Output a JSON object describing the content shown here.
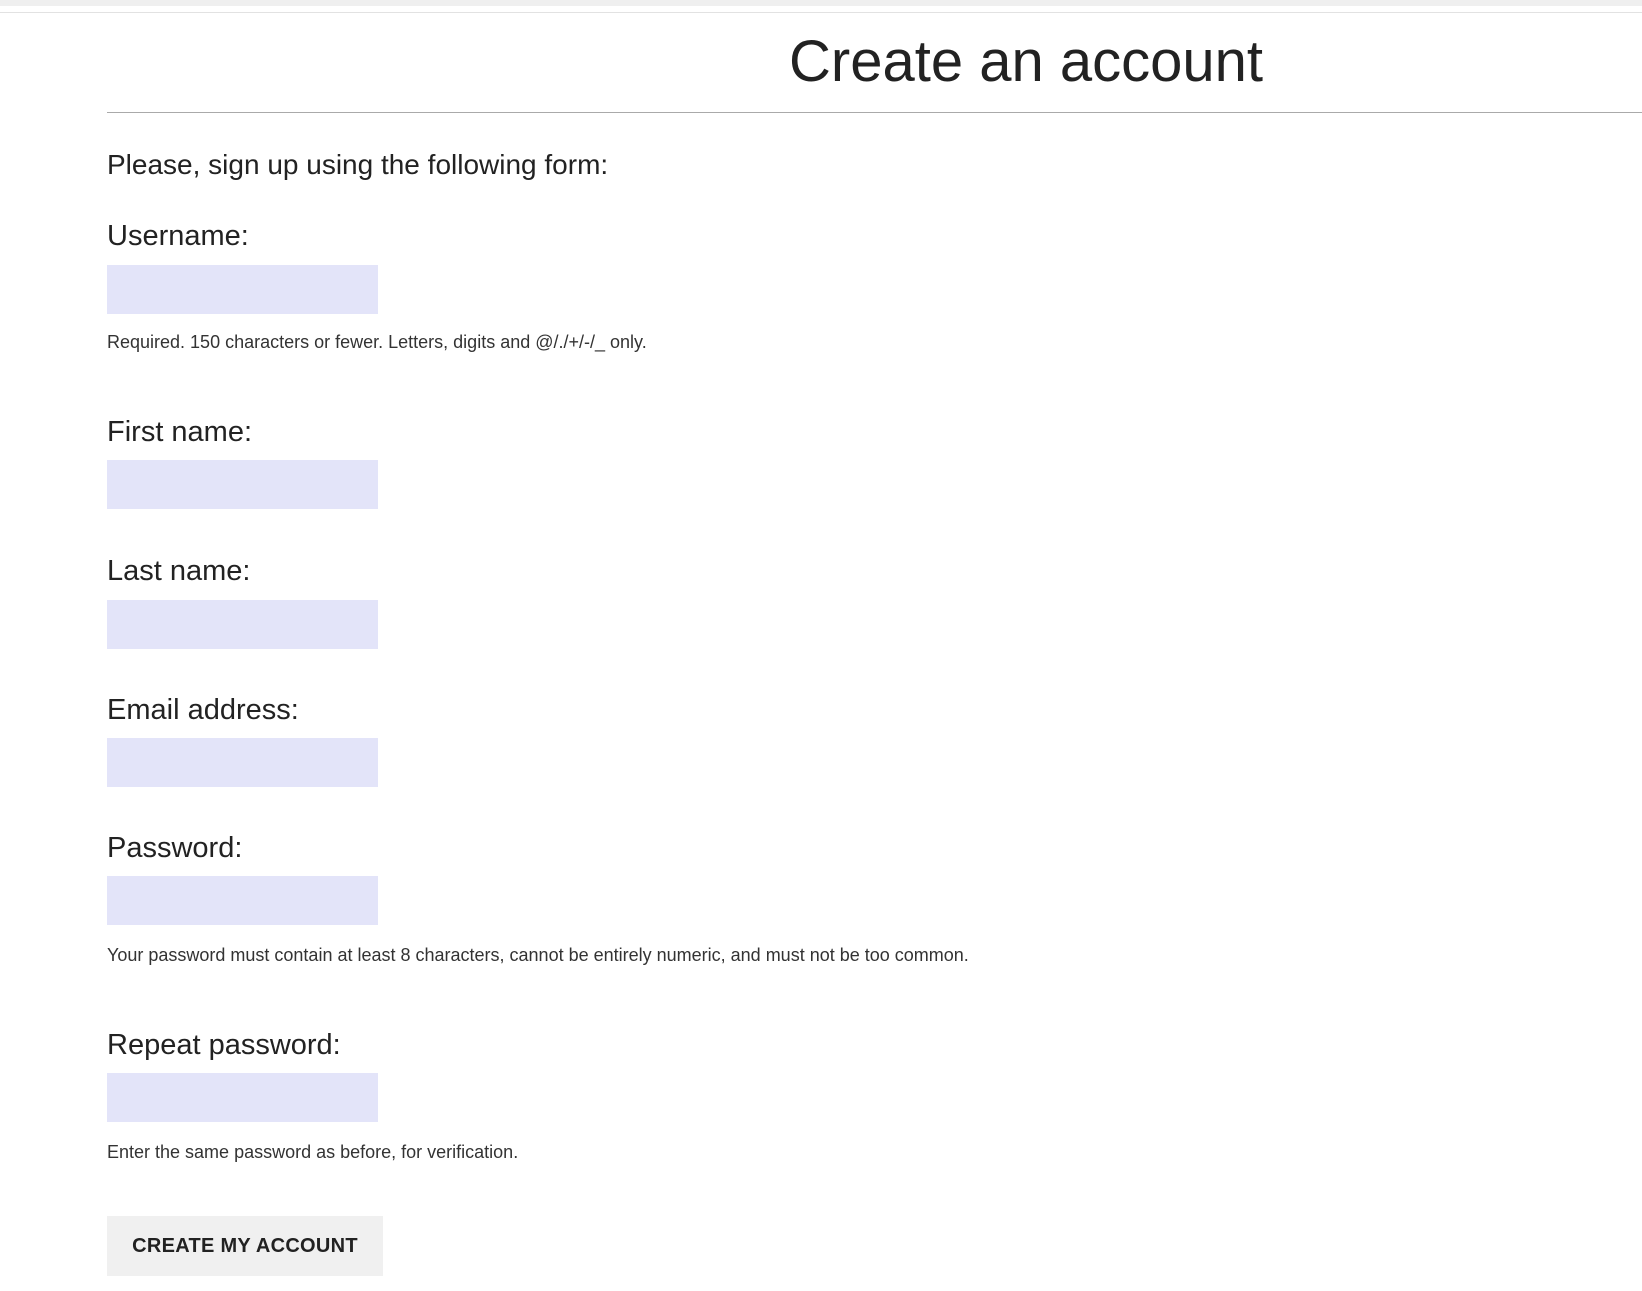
{
  "page": {
    "title": "Create an account",
    "intro": "Please, sign up using the following form:"
  },
  "form": {
    "username": {
      "label": "Username:",
      "value": "",
      "help": "Required. 150 characters or fewer. Letters, digits and @/./+/-/_ only."
    },
    "first_name": {
      "label": "First name:",
      "value": ""
    },
    "last_name": {
      "label": "Last name:",
      "value": ""
    },
    "email": {
      "label": "Email address:",
      "value": ""
    },
    "password": {
      "label": "Password:",
      "value": "",
      "help": "Your password must contain at least 8 characters, cannot be entirely numeric, and must not be too common."
    },
    "repeat_password": {
      "label": "Repeat password:",
      "value": "",
      "help": "Enter the same password as before, for verification."
    },
    "submit_label": "CREATE MY ACCOUNT"
  },
  "colors": {
    "input_background": "#e3e4f9",
    "button_background": "#f0f0f0",
    "text": "#222222"
  }
}
